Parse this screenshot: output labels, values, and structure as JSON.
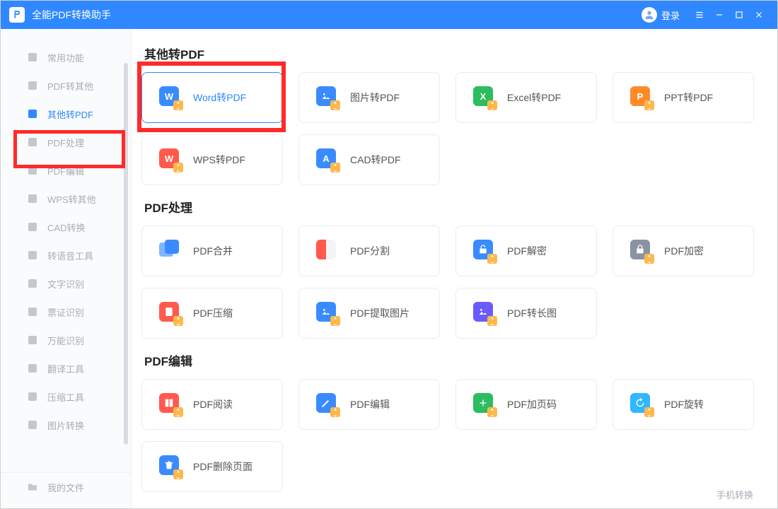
{
  "titlebar": {
    "app_name": "全能PDF转换助手",
    "login": "登录"
  },
  "sidebar": {
    "items": [
      {
        "id": "common",
        "label": "常用功能"
      },
      {
        "id": "pdf-to-other",
        "label": "PDF转其他"
      },
      {
        "id": "other-to-pdf",
        "label": "其他转PDF",
        "active": true
      },
      {
        "id": "pdf-process",
        "label": "PDF处理"
      },
      {
        "id": "pdf-edit",
        "label": "PDF编辑"
      },
      {
        "id": "wps-to-other",
        "label": "WPS转其他"
      },
      {
        "id": "cad-convert",
        "label": "CAD转换"
      },
      {
        "id": "audio-tools",
        "label": "转语音工具"
      },
      {
        "id": "ocr",
        "label": "文字识别"
      },
      {
        "id": "receipt-ocr",
        "label": "票证识别"
      },
      {
        "id": "universal-ocr",
        "label": "万能识别"
      },
      {
        "id": "translate",
        "label": "翻译工具"
      },
      {
        "id": "compress",
        "label": "压缩工具"
      },
      {
        "id": "image-convert",
        "label": "图片转换"
      }
    ],
    "bottom": {
      "id": "my-files",
      "label": "我的文件"
    }
  },
  "sections": [
    {
      "id": "other-to-pdf",
      "title": "其他转PDF",
      "cards": [
        {
          "id": "word-to-pdf",
          "label": "Word转PDF",
          "color": "blue",
          "glyph": "W",
          "active": true
        },
        {
          "id": "image-to-pdf",
          "label": "图片转PDF",
          "color": "blue",
          "glyph": "img"
        },
        {
          "id": "excel-to-pdf",
          "label": "Excel转PDF",
          "color": "green",
          "glyph": "X"
        },
        {
          "id": "ppt-to-pdf",
          "label": "PPT转PDF",
          "color": "orange",
          "glyph": "P"
        },
        {
          "id": "wps-to-pdf",
          "label": "WPS转PDF",
          "color": "red",
          "glyph": "W"
        },
        {
          "id": "cad-to-pdf",
          "label": "CAD转PDF",
          "color": "blue",
          "glyph": "A"
        }
      ]
    },
    {
      "id": "pdf-process",
      "title": "PDF处理",
      "cards": [
        {
          "id": "pdf-merge",
          "label": "PDF合并",
          "icon": "merge"
        },
        {
          "id": "pdf-split",
          "label": "PDF分割",
          "icon": "split"
        },
        {
          "id": "pdf-decrypt",
          "label": "PDF解密",
          "color": "blue",
          "glyph": "unlock"
        },
        {
          "id": "pdf-encrypt",
          "label": "PDF加密",
          "color": "grey",
          "glyph": "lock"
        },
        {
          "id": "pdf-compress",
          "label": "PDF压缩",
          "color": "red",
          "glyph": "zip"
        },
        {
          "id": "pdf-extract-image",
          "label": "PDF提取图片",
          "color": "blue",
          "glyph": "img"
        },
        {
          "id": "pdf-to-long-image",
          "label": "PDF转长图",
          "color": "purple",
          "glyph": "img"
        }
      ]
    },
    {
      "id": "pdf-edit",
      "title": "PDF编辑",
      "cards": [
        {
          "id": "pdf-read",
          "label": "PDF阅读",
          "color": "red",
          "glyph": "book"
        },
        {
          "id": "pdf-edit",
          "label": "PDF编辑",
          "color": "blue",
          "glyph": "pen"
        },
        {
          "id": "pdf-add-page",
          "label": "PDF加页码",
          "color": "green",
          "glyph": "plus"
        },
        {
          "id": "pdf-rotate",
          "label": "PDF旋转",
          "color": "cyan",
          "glyph": "rotate"
        },
        {
          "id": "pdf-delete-page",
          "label": "PDF删除页面",
          "color": "blue",
          "glyph": "trash"
        }
      ]
    }
  ],
  "footer": {
    "mobile_link": "手机转换"
  }
}
